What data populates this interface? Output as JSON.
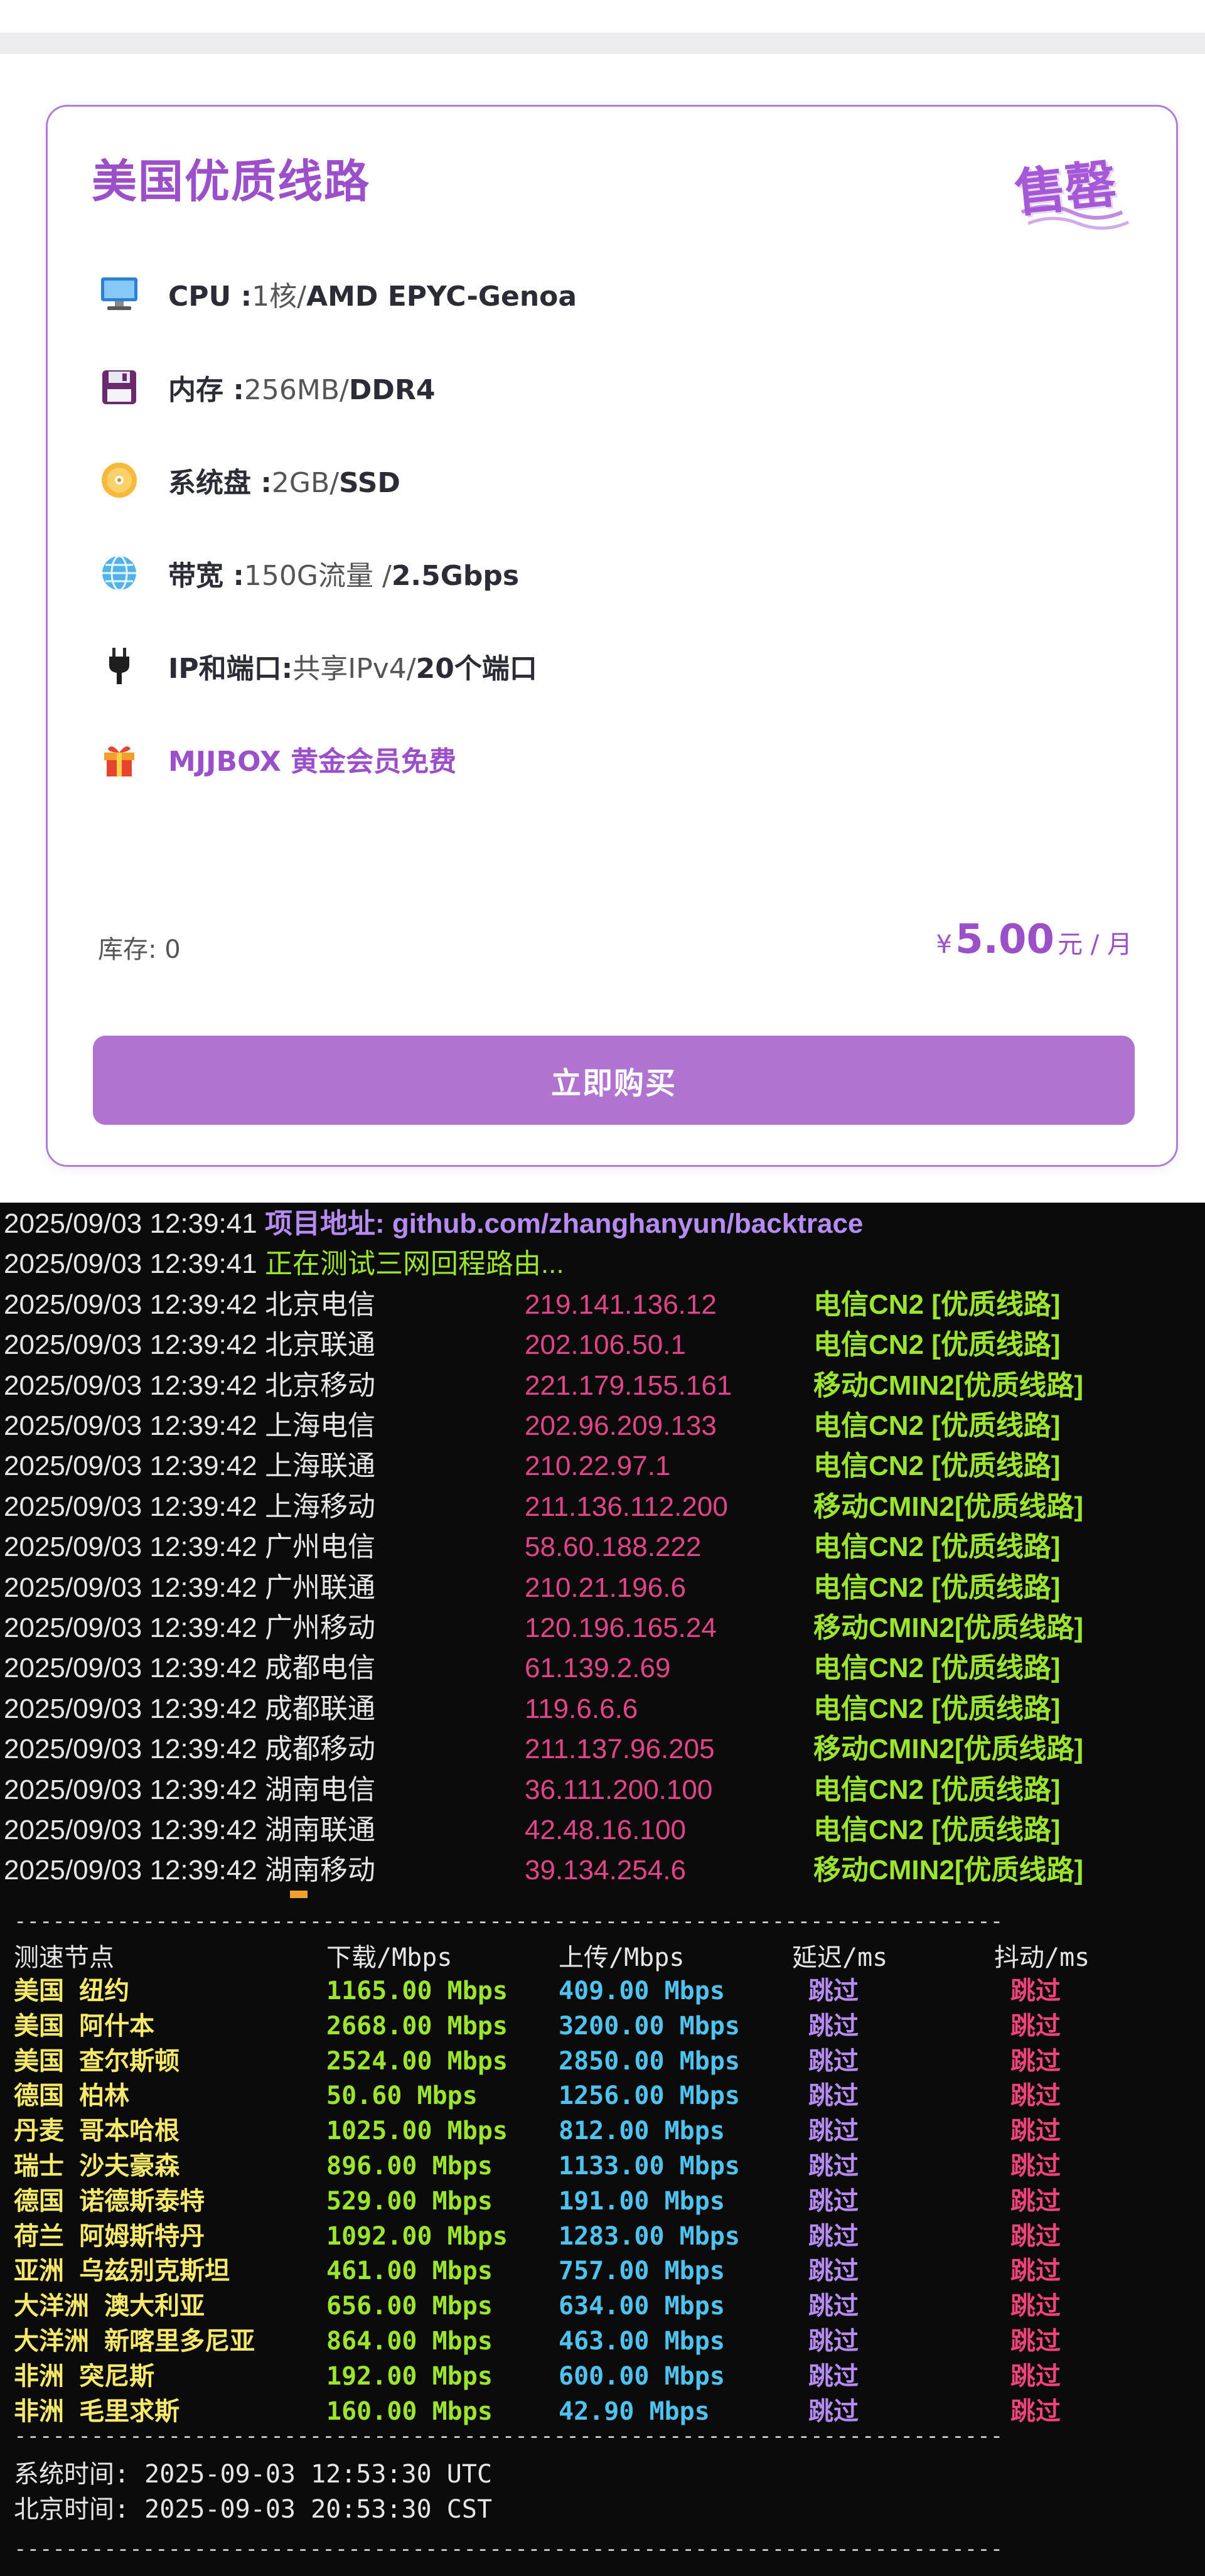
{
  "card": {
    "title": "美国优质线路",
    "stamp": "售罄",
    "specs": [
      {
        "icon": "monitor-icon",
        "label": "CPU :",
        "value": "1核/",
        "strong": "AMD EPYC-Genoa"
      },
      {
        "icon": "floppy-disk-icon",
        "label": "内存 :",
        "value": "256MB/",
        "strong": "DDR4"
      },
      {
        "icon": "disc-icon",
        "label": "系统盘 :",
        "value": "2GB/",
        "strong": "SSD"
      },
      {
        "icon": "globe-icon",
        "label": "带宽 :",
        "value": "150G流量 /",
        "strong": "2.5Gbps"
      },
      {
        "icon": "plug-icon",
        "label": "IP和端口:",
        "value": "共享IPv4/",
        "strong": "20个端口"
      },
      {
        "icon": "gift-icon",
        "label": "MJJBOX 黄金会员免费",
        "value": "",
        "strong": ""
      }
    ],
    "stock_label": "库存:",
    "stock_value": "0",
    "price_currency": "¥",
    "price_amount": "5.00",
    "price_unit": "元 / 月",
    "buy_label": "立即购买",
    "colors": {
      "accent": "#9b4fc9",
      "button": "#b073d0"
    }
  },
  "terminal": {
    "header": [
      {
        "ts": "2025/09/03 12:39:41",
        "text": "项目地址: github.com/zhanghanyun/backtrace"
      },
      {
        "ts": "2025/09/03 12:39:41",
        "text": "正在测试三网回程路由..."
      }
    ],
    "routes": [
      {
        "ts": "2025/09/03 12:39:42",
        "city": "北京电信",
        "ip": "219.141.136.12",
        "tag": "电信CN2 [优质线路]"
      },
      {
        "ts": "2025/09/03 12:39:42",
        "city": "北京联通",
        "ip": "202.106.50.1",
        "tag": "电信CN2 [优质线路]"
      },
      {
        "ts": "2025/09/03 12:39:42",
        "city": "北京移动",
        "ip": "221.179.155.161",
        "tag": "移动CMIN2[优质线路]"
      },
      {
        "ts": "2025/09/03 12:39:42",
        "city": "上海电信",
        "ip": "202.96.209.133",
        "tag": "电信CN2 [优质线路]"
      },
      {
        "ts": "2025/09/03 12:39:42",
        "city": "上海联通",
        "ip": "210.22.97.1",
        "tag": "电信CN2 [优质线路]"
      },
      {
        "ts": "2025/09/03 12:39:42",
        "city": "上海移动",
        "ip": "211.136.112.200",
        "tag": "移动CMIN2[优质线路]"
      },
      {
        "ts": "2025/09/03 12:39:42",
        "city": "广州电信",
        "ip": "58.60.188.222",
        "tag": "电信CN2 [优质线路]"
      },
      {
        "ts": "2025/09/03 12:39:42",
        "city": "广州联通",
        "ip": "210.21.196.6",
        "tag": "电信CN2 [优质线路]"
      },
      {
        "ts": "2025/09/03 12:39:42",
        "city": "广州移动",
        "ip": "120.196.165.24",
        "tag": "移动CMIN2[优质线路]"
      },
      {
        "ts": "2025/09/03 12:39:42",
        "city": "成都电信",
        "ip": "61.139.2.69",
        "tag": "电信CN2 [优质线路]"
      },
      {
        "ts": "2025/09/03 12:39:42",
        "city": "成都联通",
        "ip": "119.6.6.6",
        "tag": "电信CN2 [优质线路]"
      },
      {
        "ts": "2025/09/03 12:39:42",
        "city": "成都移动",
        "ip": "211.137.96.205",
        "tag": "移动CMIN2[优质线路]"
      },
      {
        "ts": "2025/09/03 12:39:42",
        "city": "湖南电信",
        "ip": "36.111.200.100",
        "tag": "电信CN2 [优质线路]"
      },
      {
        "ts": "2025/09/03 12:39:42",
        "city": "湖南联通",
        "ip": "42.48.16.100",
        "tag": "电信CN2 [优质线路]"
      },
      {
        "ts": "2025/09/03 12:39:42",
        "city": "湖南移动",
        "ip": "39.134.254.6",
        "tag": "移动CMIN2[优质线路]"
      }
    ],
    "separator": "-----------------------------------------------------------------------------",
    "speed_headers": [
      "测速节点",
      "下载/Mbps",
      "上传/Mbps",
      "延迟/ms",
      "抖动/ms"
    ],
    "speed_rows": [
      {
        "node": "美国 纽约",
        "dl": "1165.00 Mbps",
        "ul": "409.00 Mbps",
        "lat": "跳过",
        "jit": "跳过"
      },
      {
        "node": "美国 阿什本",
        "dl": "2668.00 Mbps",
        "ul": "3200.00 Mbps",
        "lat": "跳过",
        "jit": "跳过"
      },
      {
        "node": "美国 查尔斯顿",
        "dl": "2524.00 Mbps",
        "ul": "2850.00 Mbps",
        "lat": "跳过",
        "jit": "跳过"
      },
      {
        "node": "德国 柏林",
        "dl": "50.60 Mbps",
        "ul": "1256.00 Mbps",
        "lat": "跳过",
        "jit": "跳过"
      },
      {
        "node": "丹麦 哥本哈根",
        "dl": "1025.00 Mbps",
        "ul": "812.00 Mbps",
        "lat": "跳过",
        "jit": "跳过"
      },
      {
        "node": "瑞士 沙夫豪森",
        "dl": "896.00 Mbps",
        "ul": "1133.00 Mbps",
        "lat": "跳过",
        "jit": "跳过"
      },
      {
        "node": "德国 诺德斯泰特",
        "dl": "529.00 Mbps",
        "ul": "191.00 Mbps",
        "lat": "跳过",
        "jit": "跳过"
      },
      {
        "node": "荷兰 阿姆斯特丹",
        "dl": "1092.00 Mbps",
        "ul": "1283.00 Mbps",
        "lat": "跳过",
        "jit": "跳过"
      },
      {
        "node": "亚洲 乌兹别克斯坦",
        "dl": "461.00 Mbps",
        "ul": "757.00 Mbps",
        "lat": "跳过",
        "jit": "跳过"
      },
      {
        "node": "大洋洲 澳大利亚",
        "dl": "656.00 Mbps",
        "ul": "634.00 Mbps",
        "lat": "跳过",
        "jit": "跳过"
      },
      {
        "node": "大洋洲 新喀里多尼亚",
        "dl": "864.00 Mbps",
        "ul": "463.00 Mbps",
        "lat": "跳过",
        "jit": "跳过"
      },
      {
        "node": "非洲 突尼斯",
        "dl": "192.00 Mbps",
        "ul": "600.00 Mbps",
        "lat": "跳过",
        "jit": "跳过"
      },
      {
        "node": "非洲 毛里求斯",
        "dl": "160.00 Mbps",
        "ul": "42.90 Mbps",
        "lat": "跳过",
        "jit": "跳过"
      }
    ],
    "system_time": "系统时间: 2025-09-03 12:53:30 UTC",
    "beijing_time": "北京时间: 2025-09-03 20:53:30 CST"
  }
}
